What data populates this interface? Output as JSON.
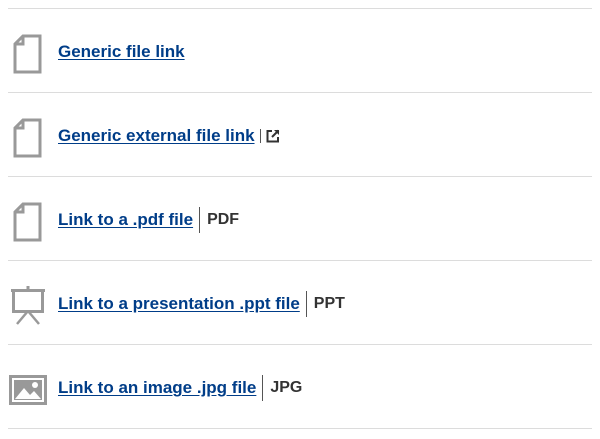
{
  "items": [
    {
      "label": "Generic file link",
      "icon": "document-icon",
      "type": ""
    },
    {
      "label": "Generic external file link",
      "icon": "document-icon",
      "type": "",
      "external_icon": "external-link-icon"
    },
    {
      "label": "Link to a .pdf file",
      "icon": "document-icon",
      "type": "PDF"
    },
    {
      "label": "Link to a presentation .ppt file",
      "icon": "presentation-icon",
      "type": "PPT"
    },
    {
      "label": "Link to an image .jpg file",
      "icon": "image-icon",
      "type": "JPG"
    }
  ],
  "colors": {
    "link": "#003d88",
    "icon": "#999999",
    "divider": "#dcdcdc",
    "type_text": "#333333"
  }
}
